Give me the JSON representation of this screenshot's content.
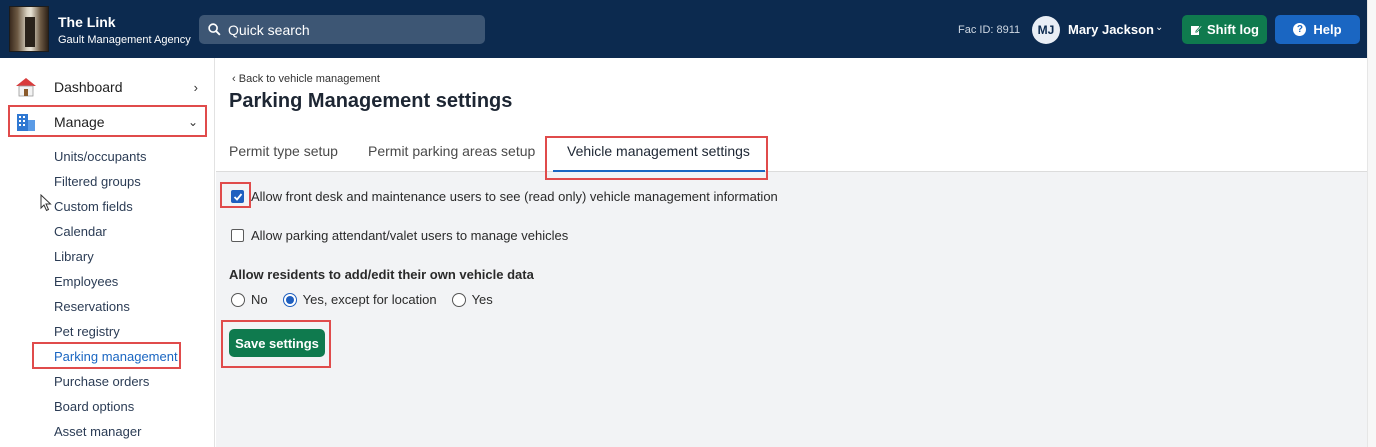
{
  "header": {
    "app_title": "The Link",
    "agency": "Gault Management Agency",
    "search_placeholder": "Quick search",
    "fac_id": "Fac ID: 8911",
    "user_initials": "MJ",
    "user_name": "Mary Jackson",
    "shift_log_label": "Shift log",
    "help_label": "Help",
    "colors": {
      "bar": "#0c2a4f",
      "shift": "#0f7a4e",
      "help": "#1a66c2"
    }
  },
  "sidebar": {
    "dashboard_label": "Dashboard",
    "manage_label": "Manage",
    "sub_items": [
      "Units/occupants",
      "Filtered groups",
      "Custom fields",
      "Calendar",
      "Library",
      "Employees",
      "Reservations",
      "Pet registry",
      "Parking management",
      "Purchase orders",
      "Board options",
      "Asset manager"
    ],
    "active_sub_item": "Parking management"
  },
  "main": {
    "back_link": "Back to vehicle management",
    "title": "Parking Management settings",
    "tabs": [
      {
        "label": "Permit type setup"
      },
      {
        "label": "Permit parking areas setup"
      },
      {
        "label": "Vehicle management settings"
      }
    ],
    "active_tab": "Vehicle management settings",
    "options": {
      "front_desk": {
        "label": "Allow front desk and maintenance users to see (read only) vehicle management information",
        "checked": true
      },
      "valet": {
        "label": "Allow parking attendant/valet users to manage vehicles",
        "checked": false
      }
    },
    "residents_label": "Allow residents to add/edit their own vehicle data",
    "resident_radios": [
      {
        "label": "No",
        "selected": false
      },
      {
        "label": "Yes, except for location",
        "selected": true
      },
      {
        "label": "Yes",
        "selected": false
      }
    ],
    "save_label": "Save settings"
  }
}
